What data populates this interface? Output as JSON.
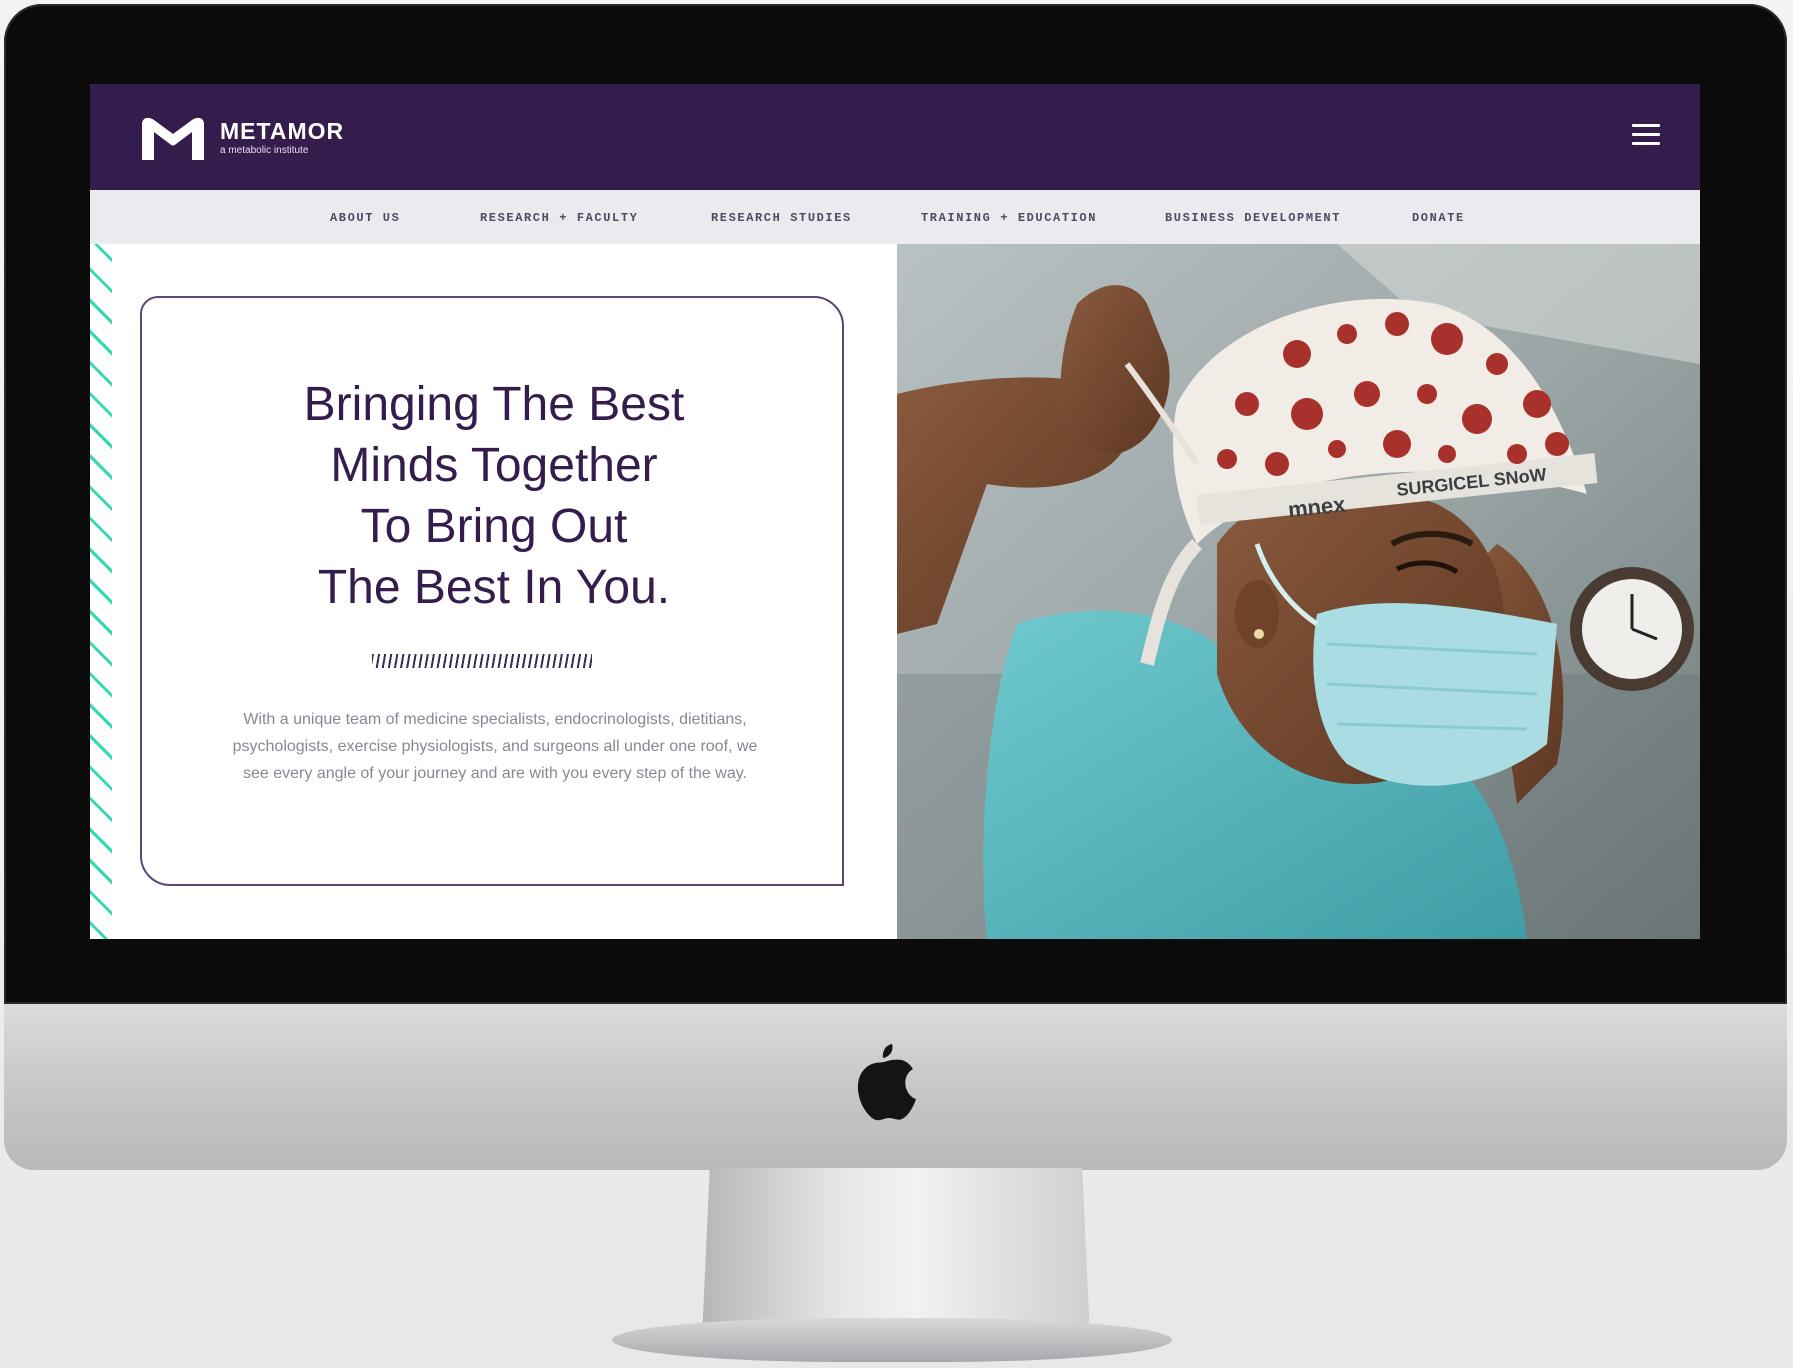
{
  "brand": {
    "name": "METAMOR",
    "tagline": "a metabolic institute"
  },
  "nav": {
    "items": [
      "ABOUT US",
      "RESEARCH + FACULTY",
      "RESEARCH STUDIES",
      "TRAINING + EDUCATION",
      "BUSINESS DEVELOPMENT",
      "DONATE"
    ]
  },
  "hero": {
    "title_lines": [
      "Bringing The Best",
      "Minds Together",
      "To Bring Out",
      "The Best In You."
    ],
    "body": "With a unique team of medicine specialists, endocrinologists, dietitians, psychologists, exercise physiologists, and surgeons all under one roof, we see every angle of your journey and are with you every step of the way."
  },
  "photo": {
    "cap_text_1": "mnex",
    "cap_text_2": "SURGICEL SNoW"
  },
  "colors": {
    "header": "#341d4d",
    "nav_bg": "#e9ebee",
    "accent_stripes": "#33d9b0",
    "title": "#341d4d"
  },
  "icons": {
    "menu": "hamburger-icon",
    "apple": "apple-logo-icon",
    "logo": "metamor-m-logo"
  }
}
